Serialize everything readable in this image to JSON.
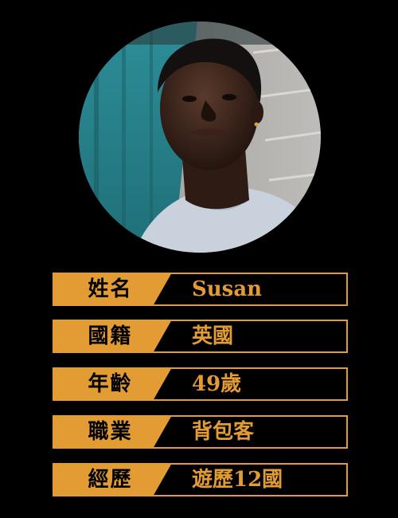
{
  "colors": {
    "accent": "#e39b34",
    "background": "#000000",
    "label_text": "#000000"
  },
  "profile": {
    "photo": "portrait-photo",
    "rows": [
      {
        "label": "姓名",
        "value": "Susan"
      },
      {
        "label": "國籍",
        "value": "英國"
      },
      {
        "label": "年齡",
        "value": "49歲"
      },
      {
        "label": "職業",
        "value": "背包客"
      },
      {
        "label": "經歷",
        "value": "遊歷12國"
      }
    ]
  }
}
